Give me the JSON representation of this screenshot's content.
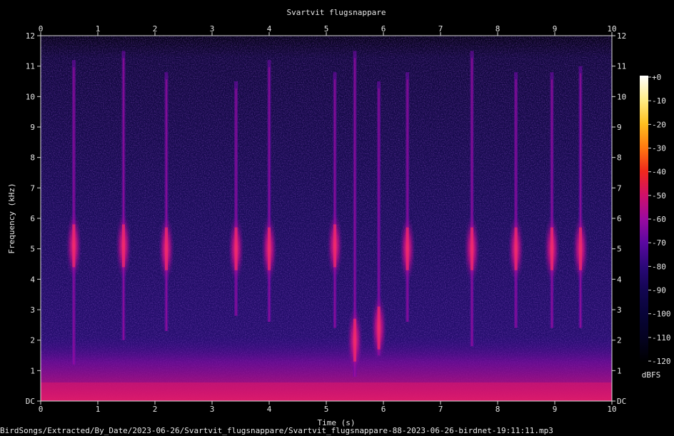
{
  "title": "Svartvit flugsnappare",
  "footer_path": "BirdSongs/Extracted/By_Date/2023-06-26/Svartvit_flugsnappare/Svartvit_flugsnappare-88-2023-06-26-birdnet-19:11:11.mp3",
  "colorbar": {
    "unit": "dBFS",
    "ticks": [
      "+0",
      "-10",
      "-20",
      "-30",
      "-40",
      "-50",
      "-60",
      "-70",
      "-80",
      "-90",
      "-100",
      "-110",
      "-120"
    ],
    "gradient": [
      "#ffffff",
      "#ffee88",
      "#ffc020",
      "#ff7a10",
      "#f0281c",
      "#d0106a",
      "#9a0aa0",
      "#5a08a0",
      "#2a0878",
      "#120650",
      "#080438",
      "#040220",
      "#000000"
    ]
  },
  "chart_data": {
    "type": "heatmap",
    "title": "Svartvit flugsnappare",
    "xlabel": "Time (s)",
    "ylabel": "Frequency (kHz)",
    "xlim": [
      0,
      10
    ],
    "ylim": [
      0,
      12
    ],
    "x_ticks": [
      "0",
      "1",
      "2",
      "3",
      "4",
      "5",
      "6",
      "7",
      "8",
      "9",
      "10"
    ],
    "y_ticks": [
      "DC",
      "1",
      "2",
      "3",
      "4",
      "5",
      "6",
      "7",
      "8",
      "9",
      "10",
      "11",
      "12"
    ],
    "value_unit": "dBFS",
    "value_range": [
      -120,
      0
    ],
    "calls": [
      {
        "t": 0.58,
        "f_low": 1.2,
        "f_high": 11.2,
        "peak": 5.1
      },
      {
        "t": 1.45,
        "f_low": 2.0,
        "f_high": 11.5,
        "peak": 5.1
      },
      {
        "t": 2.2,
        "f_low": 2.3,
        "f_high": 10.8,
        "peak": 5.0
      },
      {
        "t": 3.42,
        "f_low": 2.8,
        "f_high": 10.5,
        "peak": 5.0
      },
      {
        "t": 4.0,
        "f_low": 2.6,
        "f_high": 11.2,
        "peak": 5.0
      },
      {
        "t": 5.15,
        "f_low": 2.4,
        "f_high": 10.8,
        "peak": 5.1
      },
      {
        "t": 5.5,
        "f_low": 0.8,
        "f_high": 11.5,
        "peak": 2.0
      },
      {
        "t": 5.92,
        "f_low": 1.5,
        "f_high": 10.5,
        "peak": 2.4
      },
      {
        "t": 6.42,
        "f_low": 2.6,
        "f_high": 10.8,
        "peak": 5.0
      },
      {
        "t": 7.55,
        "f_low": 1.8,
        "f_high": 11.5,
        "peak": 5.0
      },
      {
        "t": 8.32,
        "f_low": 2.4,
        "f_high": 10.8,
        "peak": 5.0
      },
      {
        "t": 8.95,
        "f_low": 2.4,
        "f_high": 10.8,
        "peak": 5.0
      },
      {
        "t": 9.45,
        "f_low": 2.4,
        "f_high": 11.0,
        "peak": 5.0
      }
    ]
  }
}
